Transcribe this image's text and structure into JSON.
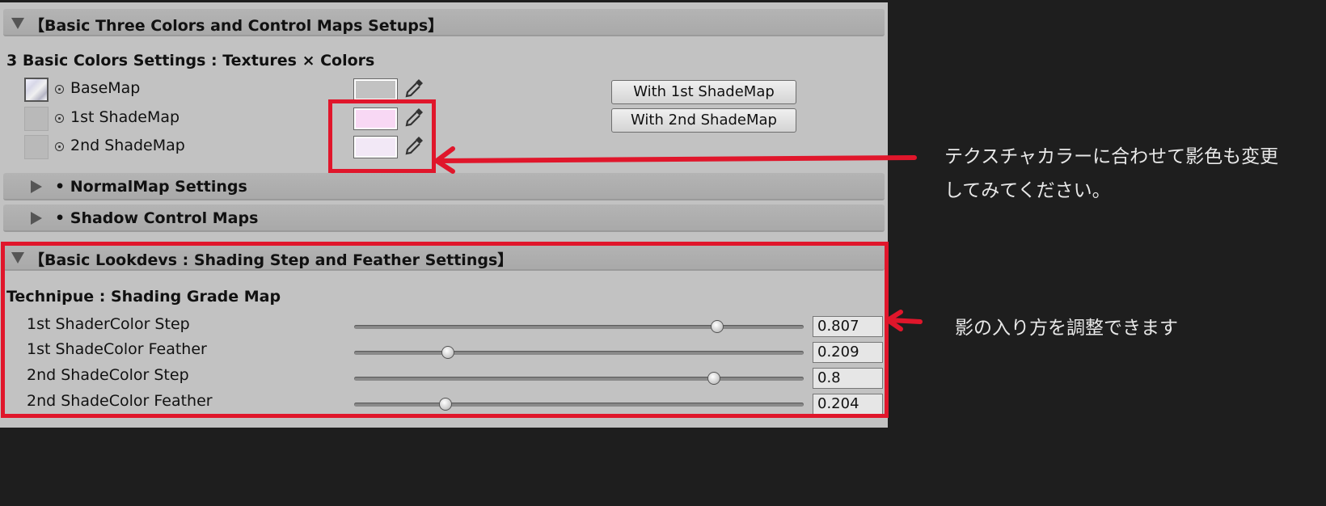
{
  "header": {
    "label": "【Basic Three Colors and Control Maps Setups】"
  },
  "basic_colors": {
    "title": "3 Basic Colors Settings : Textures × Colors",
    "rows": [
      {
        "label": "BaseMap",
        "swatch_color": "#ffffff"
      },
      {
        "label": "1st ShadeMap",
        "swatch_color": "#f8d8f4"
      },
      {
        "label": "2nd ShadeMap",
        "swatch_color": "#f2e8f6"
      }
    ],
    "buttons": {
      "with_1st": "With 1st ShadeMap",
      "with_2nd": "With 2nd ShadeMap"
    }
  },
  "normal_map": {
    "label": "• NormalMap Settings"
  },
  "shadow_control": {
    "label": "• Shadow Control Maps"
  },
  "lookdevs": {
    "header_label": "【Basic Lookdevs : Shading Step and Feather Settings】",
    "title": "Technipue : Shading Grade Map",
    "sliders": [
      {
        "label": "1st ShaderColor Step",
        "value": 0.807,
        "display": "0.807"
      },
      {
        "label": "1st ShadeColor Feather",
        "value": 0.209,
        "display": "0.209"
      },
      {
        "label": "2nd ShadeColor Step",
        "value": 0.8,
        "display": "0.8"
      },
      {
        "label": "2nd ShadeColor Feather",
        "value": 0.204,
        "display": "0.204"
      }
    ]
  },
  "annotations": {
    "color_note_line1": "テクスチャカラーに合わせて影色も変更",
    "color_note_line2": "してみてください。",
    "step_note": "影の入り方を調整できます",
    "highlight_color": "#e0162b"
  }
}
